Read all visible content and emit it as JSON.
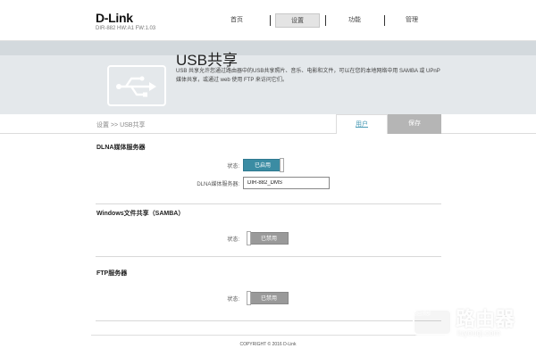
{
  "brand": {
    "logo": "D-Link",
    "model": "DIR-882 HW:A1 FW:1.03"
  },
  "nav": [
    {
      "label": "首页"
    },
    {
      "label": "设置"
    },
    {
      "label": "功能"
    },
    {
      "label": "管理"
    }
  ],
  "banner": {
    "title": "USB共享",
    "description": "USB 共享允许您通过路由器中的USB共享照片、音乐、电影和文件，可以在您的本地网络中用 SAMBA 或 UPnP媒体共享，或通过 web 使用 FTP 来访问它们。",
    "icon": "usb-icon"
  },
  "breadcrumb": "设置 >> USB共享",
  "actions": {
    "user": "用户",
    "save": "保存"
  },
  "dlna": {
    "title": "DLNA媒体服务器",
    "status_label": "状态:",
    "status_value": "已启用",
    "server_label": "DLNA媒体服务器:",
    "server_value": "DIR-882_DMS"
  },
  "samba": {
    "title": "Windows文件共享（SAMBA）",
    "status_label": "状态:",
    "status_value": "已禁用"
  },
  "ftp": {
    "title": "FTP服务器",
    "status_label": "状态:",
    "status_value": "已禁用"
  },
  "footer": {
    "copyright": "COPYRIGHT © 2016 D-Link"
  },
  "watermark": {
    "text": "路由器",
    "sub": "luyouqi.com",
    "back_top": "返回顶部"
  },
  "colors": {
    "accent": "#3b8ca3",
    "disabled": "#999999",
    "save_button": "#b5b5b5"
  }
}
